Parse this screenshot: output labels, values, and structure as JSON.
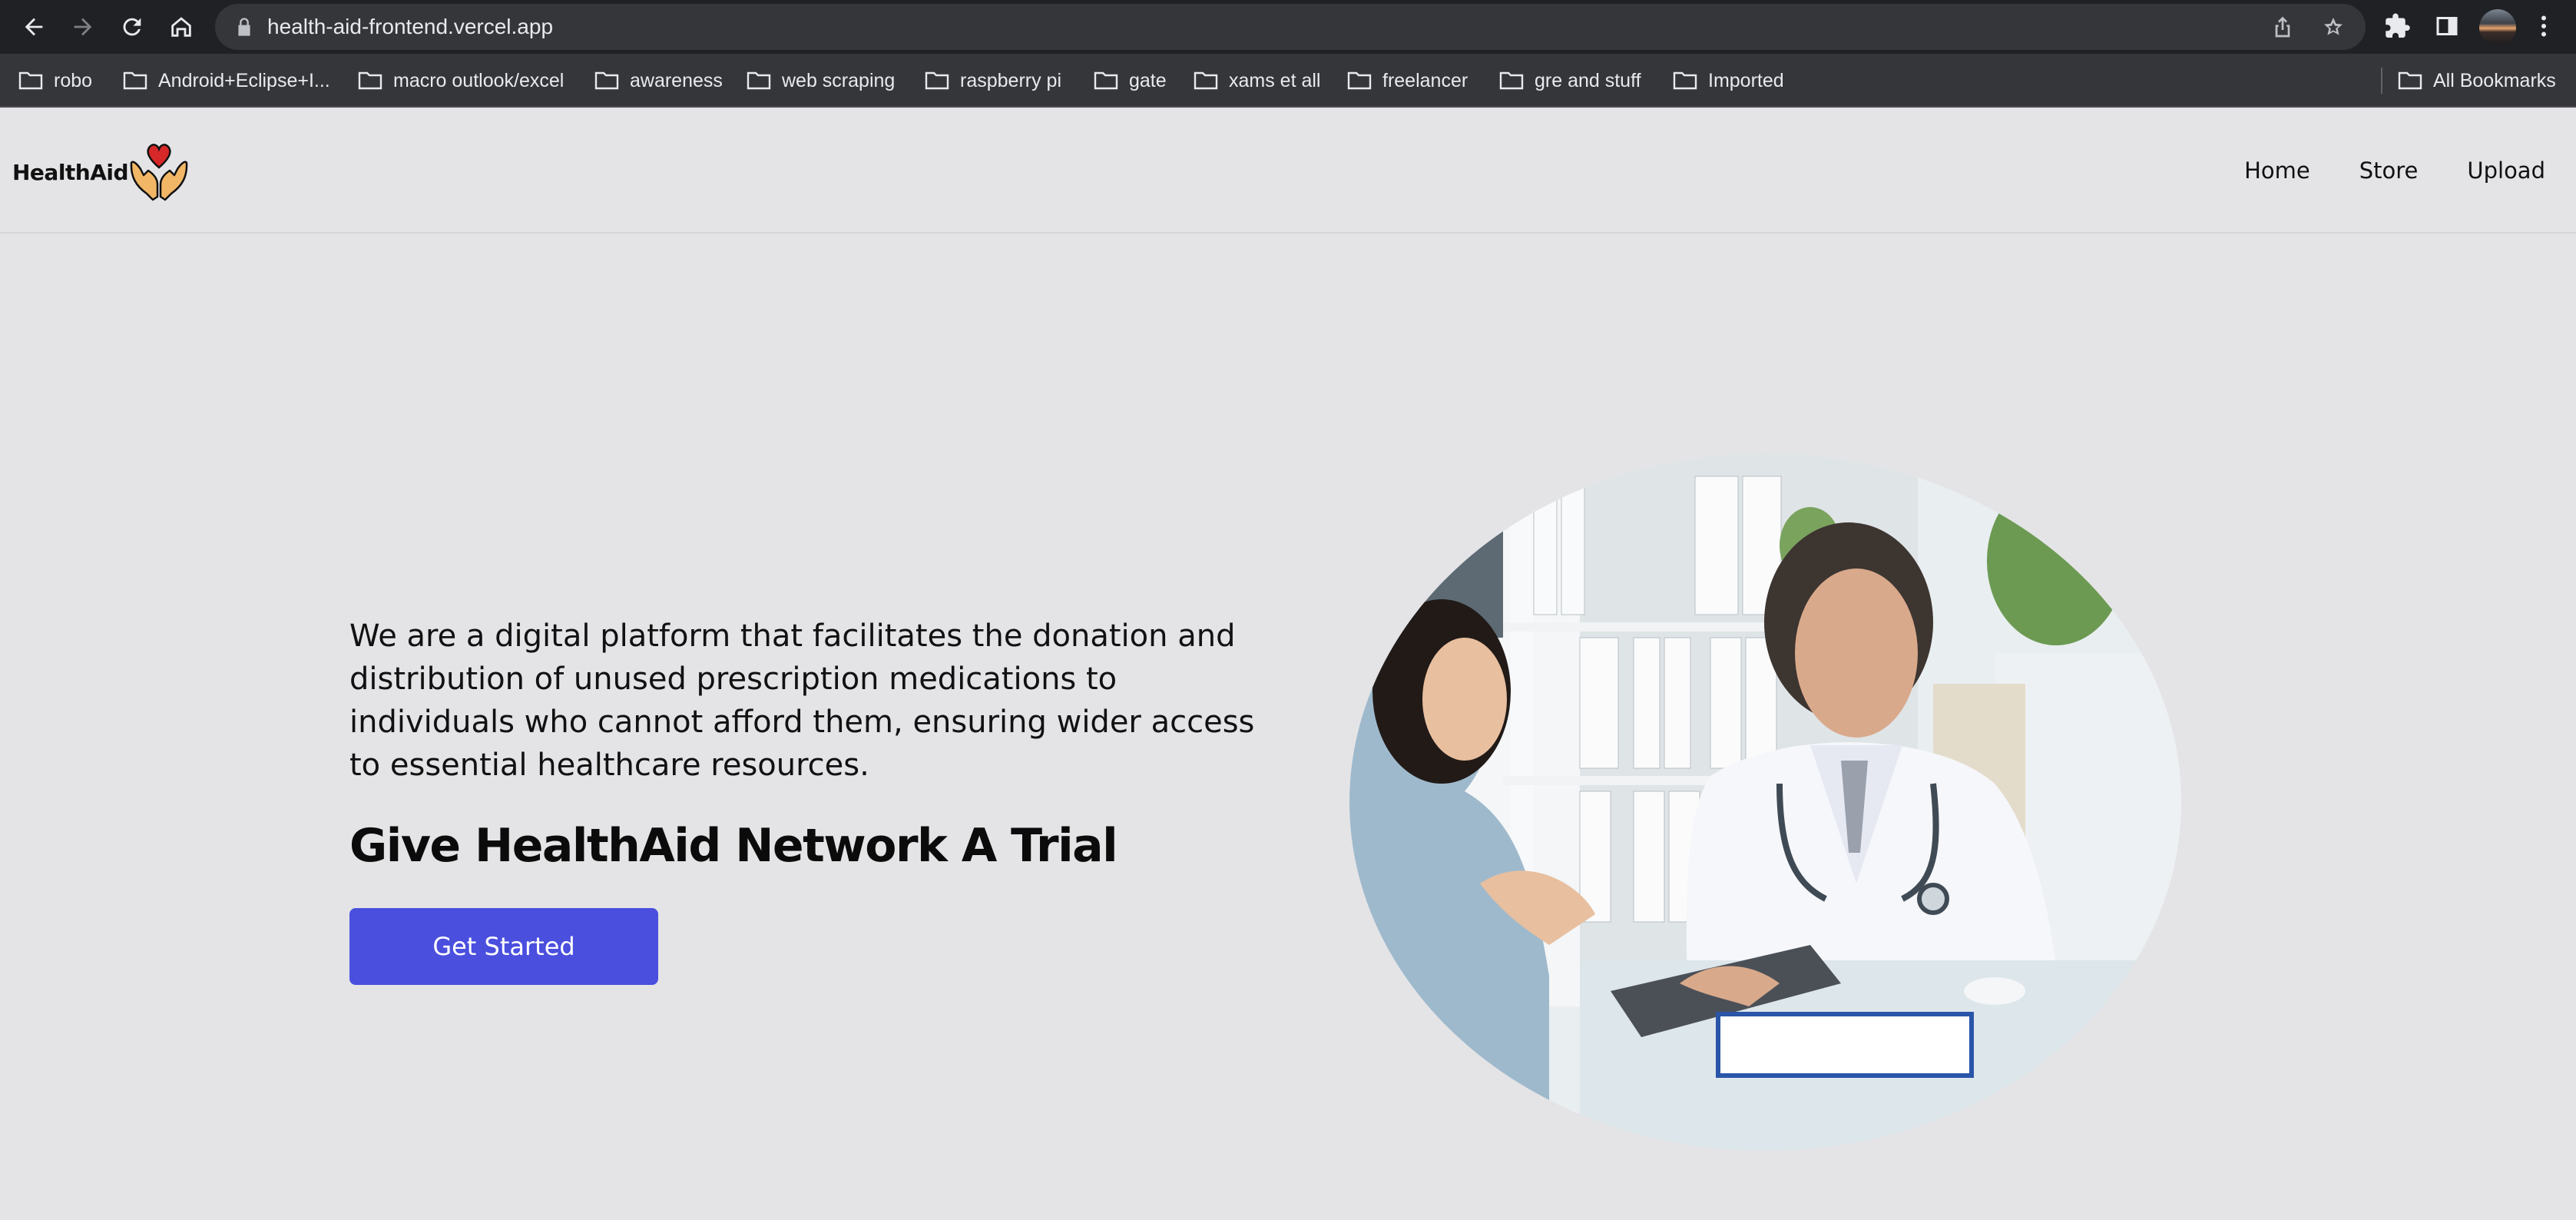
{
  "browser": {
    "url": "health-aid-frontend.vercel.app",
    "bookmarks": [
      "robo",
      "Android+Eclipse+I...",
      "macro outlook/excel",
      "awareness",
      "web scraping",
      "raspberry pi",
      "gate",
      "xams et all",
      "freelancer",
      "gre and stuff",
      "Imported"
    ],
    "all_bookmarks_label": "All Bookmarks"
  },
  "site": {
    "logo_text": "HealthAid",
    "nav": [
      "Home",
      "Store",
      "Upload"
    ]
  },
  "hero": {
    "description": "We are a digital platform that facilitates the donation and distribution of unused prescription medications to individuals who cannot afford them, ensuring wider access to essential healthcare resources.",
    "title": "Give HealthAid Network A Trial",
    "cta_label": "Get Started",
    "image_subject": "doctor-consultation-photo"
  },
  "colors": {
    "page_background": "#e4e4e7",
    "cta_background": "#4a4fde",
    "chrome_dark": "#202124",
    "chrome_bar": "#35363a",
    "logo_heart": "#d62828",
    "logo_hands": "#f2b766"
  }
}
